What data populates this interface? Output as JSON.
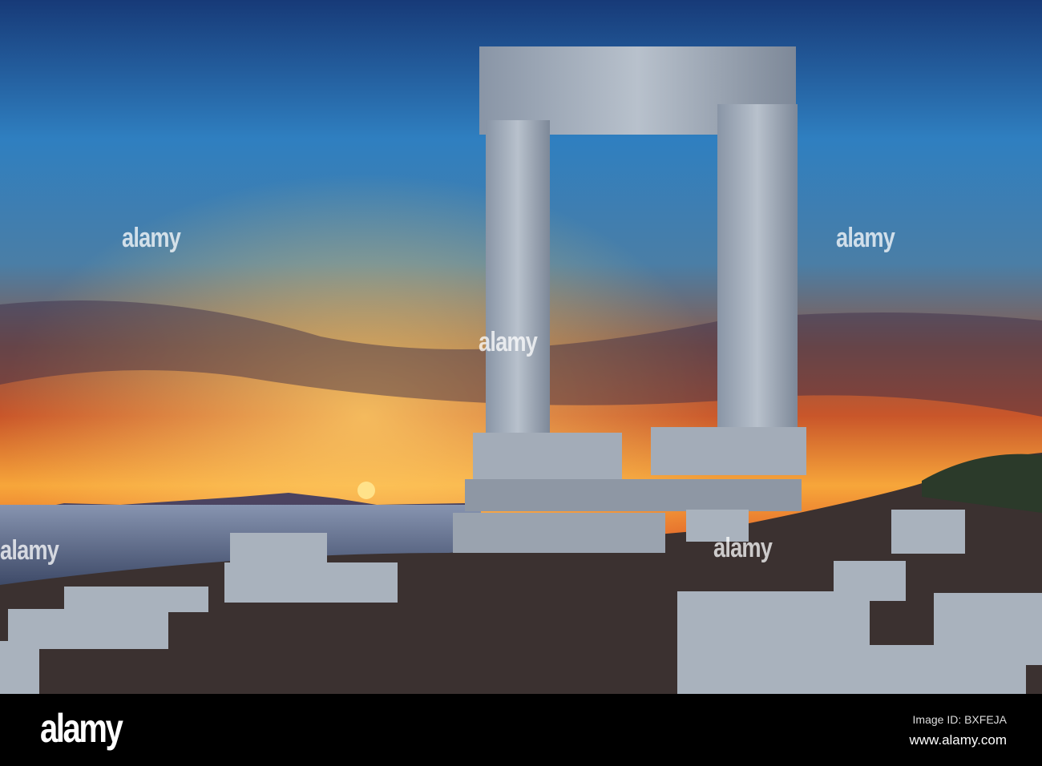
{
  "watermark": {
    "text": "alamy"
  },
  "footer": {
    "logo": "alamy",
    "image_id": "Image ID: BXFEJA",
    "website": "www.alamy.com"
  },
  "colors": {
    "sky_top": "#1b3f7a",
    "sky_mid": "#3c8bc0",
    "sunset": "#f39a2c",
    "sea": "#5a6b8a",
    "stone": "#aab4c0"
  }
}
